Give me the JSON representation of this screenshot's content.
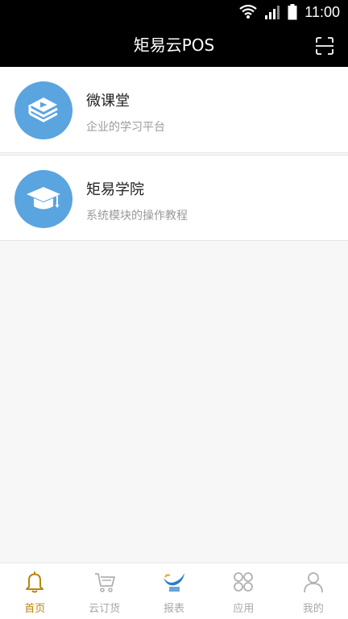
{
  "status_bar": {
    "time": "11:00"
  },
  "header": {
    "title": "矩易云POS",
    "scan_icon": "scan-icon"
  },
  "list": [
    {
      "name": "微课堂",
      "desc": "企业的学习平台",
      "icon": "play-book-icon"
    },
    {
      "name": "矩易学院",
      "desc": "系统模块的操作教程",
      "icon": "graduation-cap-icon"
    }
  ],
  "tabs": [
    {
      "label": "首页",
      "icon": "bell-icon",
      "active": true
    },
    {
      "label": "云订货",
      "icon": "cart-icon",
      "active": false
    },
    {
      "label": "报表",
      "icon": "juyi-logo-icon",
      "active": false
    },
    {
      "label": "应用",
      "icon": "apps-icon",
      "active": false
    },
    {
      "label": "我的",
      "icon": "person-icon",
      "active": false
    }
  ],
  "colors": {
    "header_bg": "#000000",
    "avatar_bg": "#5aa4e0",
    "active_tab": "#b8860b",
    "inactive_tab": "#a8a8a8"
  }
}
